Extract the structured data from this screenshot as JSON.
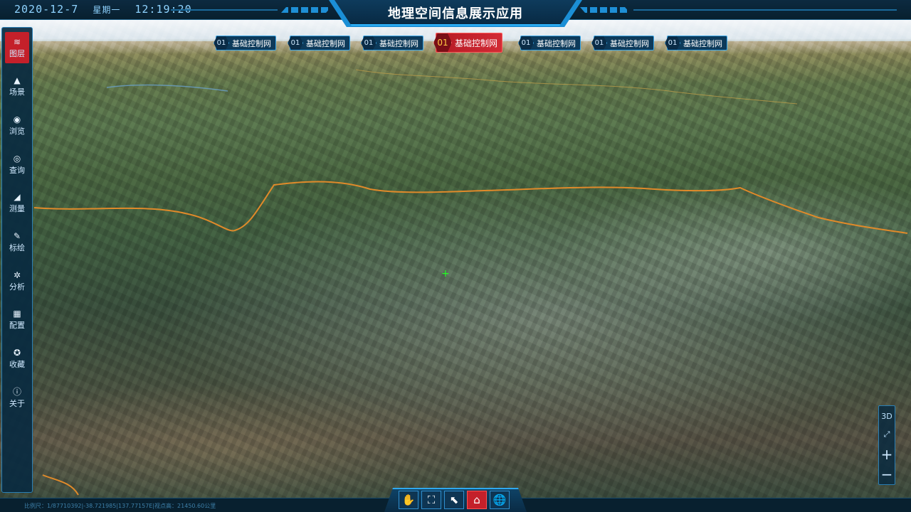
{
  "app": {
    "title": "地理空间信息展示应用"
  },
  "clock": {
    "date": "2020-12-7",
    "weekday": "星期一",
    "time": "12:19:20"
  },
  "sidebar": {
    "items": [
      {
        "label": "图层",
        "icon": "layers-icon",
        "glyph": "≋",
        "active": true
      },
      {
        "label": "场景",
        "icon": "scene-icon",
        "glyph": "▲",
        "active": false
      },
      {
        "label": "浏览",
        "icon": "eye-icon",
        "glyph": "◉",
        "active": false
      },
      {
        "label": "查询",
        "icon": "search-icon",
        "glyph": "◎",
        "active": false
      },
      {
        "label": "测量",
        "icon": "ruler-icon",
        "glyph": "◢",
        "active": false
      },
      {
        "label": "标绘",
        "icon": "pen-icon",
        "glyph": "✎",
        "active": false
      },
      {
        "label": "分析",
        "icon": "analysis-icon",
        "glyph": "✲",
        "active": false
      },
      {
        "label": "配置",
        "icon": "grid-icon",
        "glyph": "▦",
        "active": false
      },
      {
        "label": "收藏",
        "icon": "star-icon",
        "glyph": "✪",
        "active": false
      },
      {
        "label": "关于",
        "icon": "info-icon",
        "glyph": "ⓘ",
        "active": false
      }
    ]
  },
  "tabs": [
    {
      "num": "01",
      "label": "基础控制网",
      "active": false
    },
    {
      "num": "01",
      "label": "基础控制网",
      "active": false
    },
    {
      "num": "01",
      "label": "基础控制网",
      "active": false
    },
    {
      "num": "01",
      "label": "基础控制网",
      "active": true
    },
    {
      "num": "01",
      "label": "基础控制网",
      "active": false
    },
    {
      "num": "01",
      "label": "基础控制网",
      "active": false
    },
    {
      "num": "01",
      "label": "基础控制网",
      "active": false
    }
  ],
  "map_controls": {
    "mode_3d": "3D",
    "fullscreen_glyph": "⤢",
    "zoom_in": "+",
    "zoom_out": "−"
  },
  "status": {
    "scale_text": "比例尺：1/87710392|-38.721985|137.77157E|视点高：21450.60公里"
  },
  "toolbar": {
    "tools": [
      {
        "name": "pan-hand-icon",
        "glyph": "✋",
        "active": false
      },
      {
        "name": "scan-icon",
        "glyph": "⛶",
        "active": false
      },
      {
        "name": "select-cursor-icon",
        "glyph": "⬉",
        "active": false
      },
      {
        "name": "building-icon",
        "glyph": "⌂",
        "active": true
      },
      {
        "name": "globe-icon",
        "glyph": "🌐",
        "active": false
      }
    ]
  }
}
